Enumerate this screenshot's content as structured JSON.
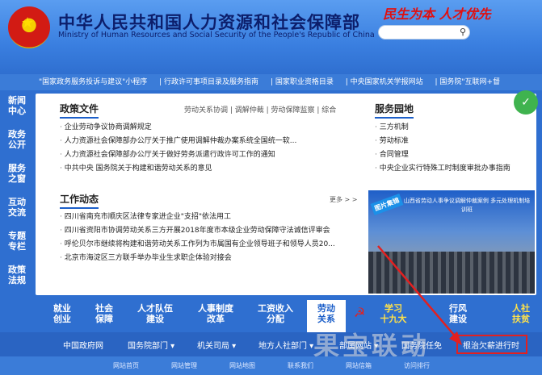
{
  "header": {
    "title_cn": "中华人民共和国人力资源和社会保障部",
    "title_en": "Ministry of Human Resources and Social Security of the People's Republic of China",
    "slogan": "民生为本 人才优先",
    "search_placeholder": ""
  },
  "ticker": [
    "\"国家政务服务投诉与建议\"小程序",
    "| 行政许可事项目录及服务指南",
    "| 国家职业资格目录",
    "| 中央国家机关学报网站",
    "| 国务院\"互联网+督"
  ],
  "leftnav": [
    "新闻中心",
    "政务公开",
    "服务之窗",
    "互动交流",
    "专题专栏",
    "政策法规"
  ],
  "policy": {
    "title": "政策文件",
    "links": "劳动关系协调 | 调解仲裁 | 劳动保障监察 | 综合",
    "items": [
      "企业劳动争议协商调解规定",
      "人力资源社会保障部办公厅关于推广使用调解仲裁办案系统全国统一软...",
      "人力资源社会保障部办公厅关于做好劳务派遣行政许可工作的通知",
      "中共中央 国务院关于构建和谐劳动关系的意见"
    ]
  },
  "service": {
    "title": "服务园地",
    "items": [
      "三方机制",
      "劳动标准",
      "合同管理",
      "中央企业实行特殊工时制度审批办事指南"
    ]
  },
  "work": {
    "title": "工作动态",
    "more": "更多 > >",
    "items": [
      "四川省南充市顺庆区法律专家进企业\"支招\"依法用工",
      "四川省资阳市协调劳动关系三方开展2018年度市本级企业劳动保障守法诚信评审会",
      "呼伦贝尔市继续将构建和谐劳动关系工作列为市属国有企业领导班子和领导人员20...",
      "北京市海淀区三方联手举办毕业生求职企体验对接会"
    ]
  },
  "photo": {
    "tag": "图片集锦",
    "banner": "山西省劳动人事争议调解仲裁案例 多元处理机制培训班"
  },
  "bottomnav": [
    {
      "label": "就业\n创业"
    },
    {
      "label": "社会\n保障"
    },
    {
      "label": "人才队伍\n建设"
    },
    {
      "label": "人事制度\n改革"
    },
    {
      "label": "工资收入\n分配"
    },
    {
      "label": "劳动\n关系"
    },
    {
      "label": "学习\n十九大"
    },
    {
      "label": "行风\n建设"
    },
    {
      "label": "人社\n扶贫"
    }
  ],
  "linkbar": [
    "中国政府网",
    "国务院部门 ▾",
    "机关司局 ▾",
    "地方人社部门 ▾",
    "部属网站 ▾",
    "国务院任免",
    "根治欠薪进行时"
  ],
  "footer": [
    "网站首页",
    "网站管理",
    "网站地图",
    "联系我们",
    "网站信箱",
    "访问排行"
  ],
  "watermark": "果宝联动",
  "colors": {
    "brand": "#2f6fd0",
    "accent_red": "#e32020",
    "panel": "#ffffff"
  }
}
